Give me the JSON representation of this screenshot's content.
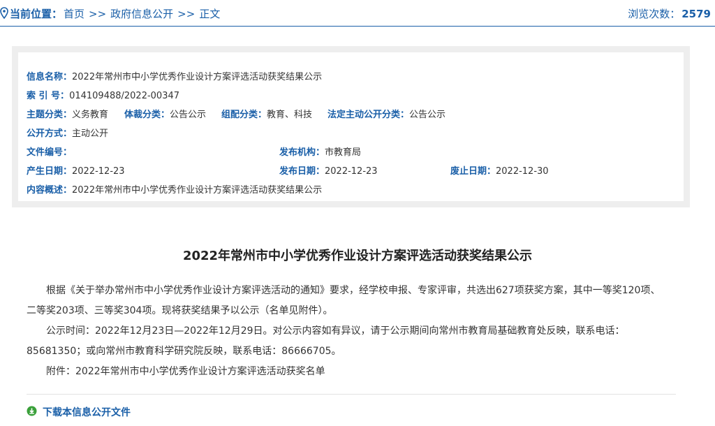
{
  "breadcrumb": {
    "label": "当前位置：",
    "items": [
      "首页",
      "政府信息公开",
      "正文"
    ],
    "separator": ">>"
  },
  "views": {
    "label": "浏览次数：",
    "count": "2579"
  },
  "meta": {
    "info_name": {
      "label": "信息名称：",
      "value": "2022年常州市中小学优秀作业设计方案评选活动获奖结果公示"
    },
    "index_no": {
      "label": "索 引 号：",
      "value": "014109488/2022-00347"
    },
    "topic": {
      "label": "主题分类：",
      "value": "义务教育"
    },
    "genre": {
      "label": "体裁分类：",
      "value": "公告公示"
    },
    "org_class": {
      "label": "组配分类：",
      "value": "教育、科技"
    },
    "legal_class": {
      "label": "法定主动公开分类：",
      "value": "公告公示"
    },
    "open_mode": {
      "label": "公开方式：",
      "value": "主动公开"
    },
    "doc_no": {
      "label": "文件编号：",
      "value": ""
    },
    "publisher": {
      "label": "发布机构：",
      "value": "市教育局"
    },
    "created": {
      "label": "产生日期：",
      "value": "2022-12-23"
    },
    "published": {
      "label": "发布日期：",
      "value": "2022-12-23"
    },
    "expires": {
      "label": "废止日期：",
      "value": "2022-12-30"
    },
    "summary": {
      "label": "内容概述：",
      "value": "2022年常州市中小学优秀作业设计方案评选活动获奖结果公示"
    }
  },
  "article": {
    "title": "2022年常州市中小学优秀作业设计方案评选活动获奖结果公示",
    "paragraphs": [
      "根据《关于举办常州市中小学优秀作业设计方案评选活动的通知》要求，经学校申报、专家评审，共选出627项获奖方案，其中一等奖120项、二等奖203项、三等奖304项。现将获奖结果予以公示（名单见附件）。",
      "公示时间：2022年12月23日—2022年12月29日。对公示内容如有异议，请于公示期间向常州市教育局基础教育处反映，联系电话：85681350；或向常州市教育科学研究院反映，联系电话：86666705。",
      "附件：2022年常州市中小学优秀作业设计方案评选活动获奖名单"
    ]
  },
  "download": {
    "label": "下载本信息公开文件",
    "icon": "download-circle-icon"
  },
  "colors": {
    "accent": "#1a5fa8",
    "download_icon": "#3aa03a",
    "frame": "#eeeeee"
  }
}
